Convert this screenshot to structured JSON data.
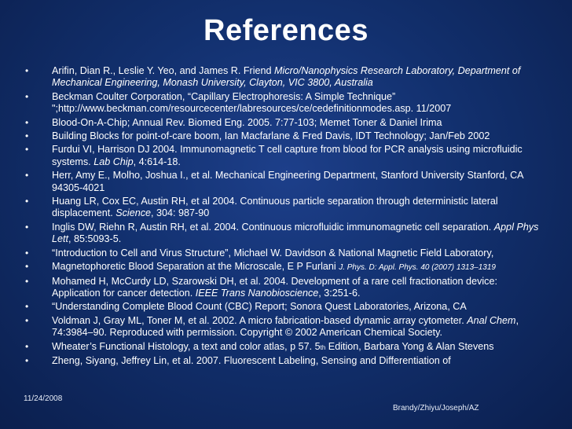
{
  "title": "References",
  "refs": [
    {
      "pre": "Arifin, Dian R., Leslie Y. Yeo, and James R. Friend ",
      "it": "Micro/Nanophysics Research Laboratory, Department of Mechanical Engineering, Monash University, Clayton, VIC 3800, Australia",
      "post": ""
    },
    {
      "pre": "Beckman Coulter Corporation, “Capillary Electrophoresis: A Simple Technique” \";http://www.beckman.com/resourcecenter/labresources/ce/cedefinitionmodes.asp. 11/2007",
      "it": "",
      "post": ""
    },
    {
      "pre": "Blood-On-A-Chip; Annual Rev. Biomed Eng. 2005. 7:77-103; Memet Toner & Daniel Irima",
      "it": "",
      "post": ""
    },
    {
      "pre": "Building Blocks for point-of-care boom, Ian Macfarlane & Fred Davis, IDT Technology; Jan/Feb 2002",
      "it": "",
      "post": ""
    },
    {
      "pre": "Furdui VI, Harrison DJ 2004. Immunomagnetic T cell capture from blood for PCR analysis using microfluidic systems. ",
      "it": "Lab Chip",
      "post": ", 4:614-18."
    },
    {
      "pre": "Herr, Amy E., Molho, Joshua I., et al. Mechanical Engineering Department, Stanford University Stanford, CA 94305-4021",
      "it": "",
      "post": ""
    },
    {
      "pre": "Huang LR, Cox EC, Austin RH, et al 2004. Continuous particle separation through deterministic lateral displacement. ",
      "it": "Science",
      "post": ", 304: 987-90"
    },
    {
      "pre": "Inglis DW, Riehn R, Austin RH, et al. 2004. Continuous microfluidic immunomagnetic cell separation. ",
      "it": "Appl Phys Lett",
      "post": ", 85:5093-5."
    },
    {
      "pre": "“Introduction to Cell and Virus Structure”, Michael W. Davidson & National Magnetic Field Laboratory,",
      "it": "",
      "post": ""
    },
    {
      "pre": "Magnetophoretic Blood Separation at the Microscale, E P Furlani ",
      "small": "J. Phys. D: Appl. Phys. 40 (2007) 1313–1319",
      "it": "",
      "post": ""
    },
    {
      "pre": "Mohamed H, McCurdy LD, Szarowski DH, et al. 2004. Development of a rare cell fractionation device: Application for cancer detection. ",
      "it": "IEEE Trans Nanobioscience",
      "post": ", 3:251-6."
    },
    {
      "pre": "“Understanding Complete Blood Count (CBC) Report; Sonora Quest Laboratories, Arizona, CA",
      "it": "",
      "post": ""
    },
    {
      "pre": "Voldman J, Gray ML, Toner M, et al. 2002. A micro fabrication-based dynamic array cytometer. ",
      "it": "Anal Chem",
      "post": ", 74:3984–90. Reproduced with permission. Copyright © 2002 American Chemical Society."
    },
    {
      "pre": "Wheater’s Functional Histology, a text and color atlas, p 57. 5",
      "sup": "th",
      "post2": " Edition, Barbara Yong & Alan Stevens",
      "it": "",
      "post": ""
    },
    {
      "pre": "Zheng, Siyang, Jeffrey Lin, et al. 2007. Fluorescent Labeling, Sensing and Differentiation of",
      "it": "",
      "post": ""
    }
  ],
  "footer": {
    "date": "11/24/2008",
    "authors": "Brandy/Zhiyu/Joseph/AZ"
  }
}
